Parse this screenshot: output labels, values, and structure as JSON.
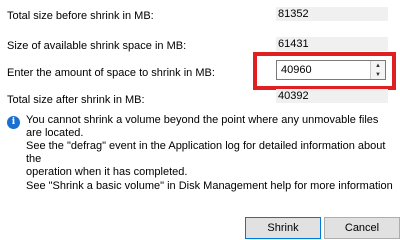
{
  "fields": {
    "total_size": {
      "label": "Total size before shrink in MB:",
      "value": "81352"
    },
    "available": {
      "label": "Size of available shrink space in MB:",
      "value": "61431"
    },
    "amount": {
      "label": "Enter the amount of space to shrink in MB:",
      "value": "40960"
    },
    "after": {
      "label": "Total size after shrink in MB:",
      "value": "40392"
    }
  },
  "info": {
    "line1": "You cannot shrink a volume beyond the point where any unmovable files are located.",
    "line2": "See the \"defrag\" event in the Application log for detailed information about the",
    "line3": "operation when it has completed."
  },
  "help_text": "See \"Shrink a basic volume\" in Disk Management help for more information",
  "buttons": {
    "shrink": "Shrink",
    "cancel": "Cancel"
  },
  "colors": {
    "highlight": "#e02020",
    "info_icon": "#1a6fd0"
  },
  "icons": {
    "info": "information-icon",
    "spin_up": "arrow-up-icon",
    "spin_down": "arrow-down-icon"
  }
}
